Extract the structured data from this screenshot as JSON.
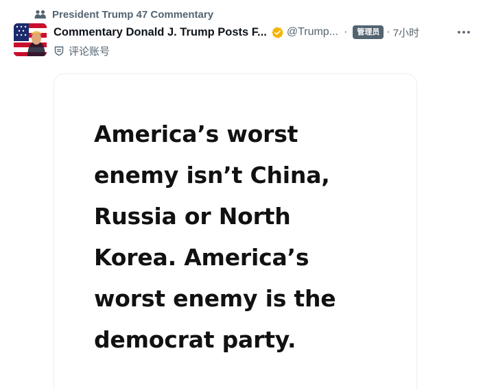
{
  "community": {
    "name": "President Trump 47 Commentary",
    "icon": "community-icon"
  },
  "post": {
    "display_name": "Commentary Donald J. Trump Posts F...",
    "handle": "@Trump...",
    "separator": "·",
    "admin_badge": "管理员",
    "time_separator": "·",
    "timestamp": "7小时",
    "sub_label": "评论账号",
    "more_icon": "more-horizontal-icon",
    "verified_icon": "verified-badge-icon",
    "verified_color": "#f5b400",
    "media": {
      "lines": [
        "America’s worst",
        "enemy isn’t China,",
        "Russia or North",
        "Korea. America’s",
        "worst enemy is the",
        "democrat party."
      ]
    }
  }
}
